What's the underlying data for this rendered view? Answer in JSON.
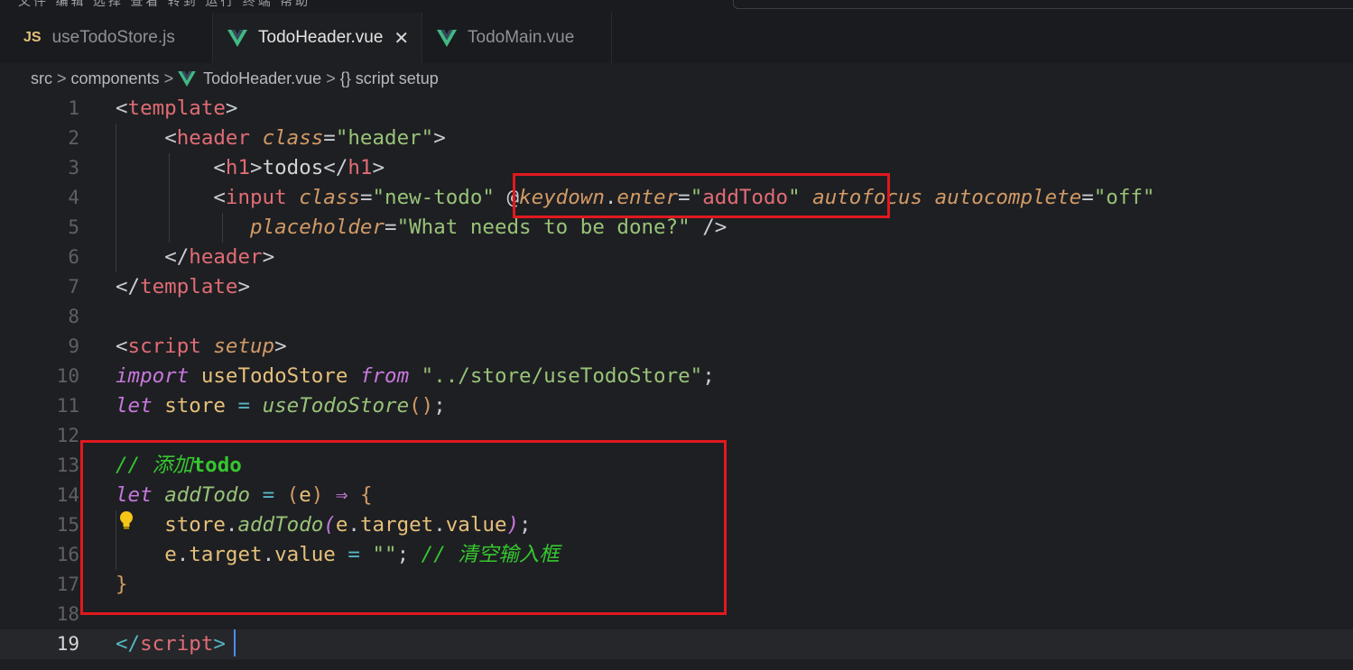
{
  "tabs": [
    {
      "label": "useTodoStore.js",
      "icon": "js-icon",
      "active": false
    },
    {
      "label": "TodoHeader.vue",
      "icon": "vue-icon",
      "active": true,
      "close": "✕"
    },
    {
      "label": "TodoMain.vue",
      "icon": "vue-icon",
      "active": false
    }
  ],
  "breadcrumb": {
    "parts": [
      "src",
      "components",
      "TodoHeader.vue",
      "{} script setup"
    ],
    "separator": ">"
  },
  "colors": {
    "background": "#1e1f22",
    "tab_bar": "#1a1b1e",
    "highlight_box": "#e0191f",
    "vue_icon": "#42b883",
    "js_icon": "#e5c07b",
    "caret": "#528bff"
  },
  "editor": {
    "current_line": 19,
    "lines": [
      {
        "n": "1",
        "tokens": [
          [
            "t-punc",
            "<"
          ],
          [
            "t-tag",
            "template"
          ],
          [
            "t-punc",
            ">"
          ]
        ]
      },
      {
        "n": "2",
        "tokens": [
          [
            "t-txt",
            "    "
          ],
          [
            "t-punc",
            "<"
          ],
          [
            "t-tag",
            "header"
          ],
          [
            "t-txt",
            " "
          ],
          [
            "t-attr",
            "class"
          ],
          [
            "t-punc",
            "="
          ],
          [
            "t-str",
            "\"header\""
          ],
          [
            "t-punc",
            ">"
          ]
        ]
      },
      {
        "n": "3",
        "tokens": [
          [
            "t-txt",
            "        "
          ],
          [
            "t-punc",
            "<"
          ],
          [
            "t-tag",
            "h1"
          ],
          [
            "t-punc",
            ">"
          ],
          [
            "t-txt",
            "todos"
          ],
          [
            "t-punc",
            "</"
          ],
          [
            "t-tag",
            "h1"
          ],
          [
            "t-punc",
            ">"
          ]
        ]
      },
      {
        "n": "4",
        "tokens": [
          [
            "t-txt",
            "        "
          ],
          [
            "t-punc",
            "<"
          ],
          [
            "t-tag",
            "input"
          ],
          [
            "t-txt",
            " "
          ],
          [
            "t-attr",
            "class"
          ],
          [
            "t-punc",
            "="
          ],
          [
            "t-str",
            "\"new-todo\""
          ],
          [
            "t-txt",
            " "
          ],
          [
            "t-punc",
            "@"
          ],
          [
            "t-attr",
            "keydown"
          ],
          [
            "t-punc",
            "."
          ],
          [
            "t-attr",
            "enter"
          ],
          [
            "t-punc",
            "="
          ],
          [
            "t-str",
            "\""
          ],
          [
            "t-tag",
            "addTodo"
          ],
          [
            "t-str",
            "\""
          ],
          [
            "t-txt",
            " "
          ],
          [
            "t-attr",
            "autofocus"
          ],
          [
            "t-txt",
            " "
          ],
          [
            "t-attr",
            "autocomplete"
          ],
          [
            "t-punc",
            "="
          ],
          [
            "t-str",
            "\"off\""
          ]
        ]
      },
      {
        "n": "5",
        "tokens": [
          [
            "t-txt",
            "           "
          ],
          [
            "t-attr",
            "placeholder"
          ],
          [
            "t-punc",
            "="
          ],
          [
            "t-str",
            "\"What needs to be done?\""
          ],
          [
            "t-txt",
            " "
          ],
          [
            "t-punc",
            "/>"
          ]
        ]
      },
      {
        "n": "6",
        "tokens": [
          [
            "t-txt",
            "    "
          ],
          [
            "t-punc",
            "</"
          ],
          [
            "t-tag",
            "header"
          ],
          [
            "t-punc",
            ">"
          ]
        ]
      },
      {
        "n": "7",
        "tokens": [
          [
            "t-punc",
            "</"
          ],
          [
            "t-tag",
            "template"
          ],
          [
            "t-punc",
            ">"
          ]
        ]
      },
      {
        "n": "8",
        "tokens": []
      },
      {
        "n": "9",
        "tokens": [
          [
            "t-punc",
            "<"
          ],
          [
            "t-tag",
            "script"
          ],
          [
            "t-txt",
            " "
          ],
          [
            "t-attr",
            "setup"
          ],
          [
            "t-punc",
            ">"
          ]
        ]
      },
      {
        "n": "10",
        "tokens": [
          [
            "t-kw",
            "import"
          ],
          [
            "t-txt",
            " "
          ],
          [
            "t-var",
            "useTodoStore"
          ],
          [
            "t-txt",
            " "
          ],
          [
            "t-kw",
            "from"
          ],
          [
            "t-txt",
            " "
          ],
          [
            "t-str",
            "\"../store/useTodoStore\""
          ],
          [
            "t-punc",
            ";"
          ]
        ]
      },
      {
        "n": "11",
        "tokens": [
          [
            "t-kw",
            "let"
          ],
          [
            "t-txt",
            " "
          ],
          [
            "t-var",
            "store"
          ],
          [
            "t-txt",
            " "
          ],
          [
            "t-op",
            "="
          ],
          [
            "t-txt",
            " "
          ],
          [
            "t-fn",
            "useTodoStore"
          ],
          [
            "t-brace",
            "()"
          ],
          [
            "t-punc",
            ";"
          ]
        ]
      },
      {
        "n": "12",
        "tokens": []
      },
      {
        "n": "13",
        "tokens": [
          [
            "t-cmt",
            "// 添加"
          ],
          [
            "t-cmtb",
            "todo"
          ]
        ]
      },
      {
        "n": "14",
        "tokens": [
          [
            "t-kw",
            "let"
          ],
          [
            "t-txt",
            " "
          ],
          [
            "t-fn",
            "addTodo"
          ],
          [
            "t-txt",
            " "
          ],
          [
            "t-op",
            "="
          ],
          [
            "t-txt",
            " "
          ],
          [
            "t-brace",
            "("
          ],
          [
            "t-var",
            "e"
          ],
          [
            "t-brace",
            ")"
          ],
          [
            "t-txt",
            " "
          ],
          [
            "t-kw",
            "⇒"
          ],
          [
            "t-txt",
            " "
          ],
          [
            "t-brace",
            "{"
          ]
        ]
      },
      {
        "n": "15",
        "tokens": [
          [
            "t-txt",
            "    "
          ],
          [
            "t-var",
            "store"
          ],
          [
            "t-punc",
            "."
          ],
          [
            "t-fn",
            "addTodo"
          ],
          [
            "t-kw",
            "("
          ],
          [
            "t-var",
            "e"
          ],
          [
            "t-punc",
            "."
          ],
          [
            "t-prop",
            "target"
          ],
          [
            "t-punc",
            "."
          ],
          [
            "t-prop",
            "value"
          ],
          [
            "t-kw",
            ")"
          ],
          [
            "t-punc",
            ";"
          ]
        ]
      },
      {
        "n": "16",
        "tokens": [
          [
            "t-txt",
            "    "
          ],
          [
            "t-var",
            "e"
          ],
          [
            "t-punc",
            "."
          ],
          [
            "t-prop",
            "target"
          ],
          [
            "t-punc",
            "."
          ],
          [
            "t-prop",
            "value"
          ],
          [
            "t-txt",
            " "
          ],
          [
            "t-op",
            "="
          ],
          [
            "t-txt",
            " "
          ],
          [
            "t-str",
            "\"\""
          ],
          [
            "t-punc",
            ";"
          ],
          [
            "t-txt",
            " "
          ],
          [
            "t-cmt",
            "// 清空输入框"
          ]
        ]
      },
      {
        "n": "17",
        "tokens": [
          [
            "t-brace",
            "}"
          ]
        ]
      },
      {
        "n": "18",
        "tokens": []
      },
      {
        "n": "19",
        "tokens": [
          [
            "t-op",
            "</"
          ],
          [
            "t-tag",
            "script"
          ],
          [
            "t-op",
            ">"
          ]
        ]
      }
    ]
  }
}
